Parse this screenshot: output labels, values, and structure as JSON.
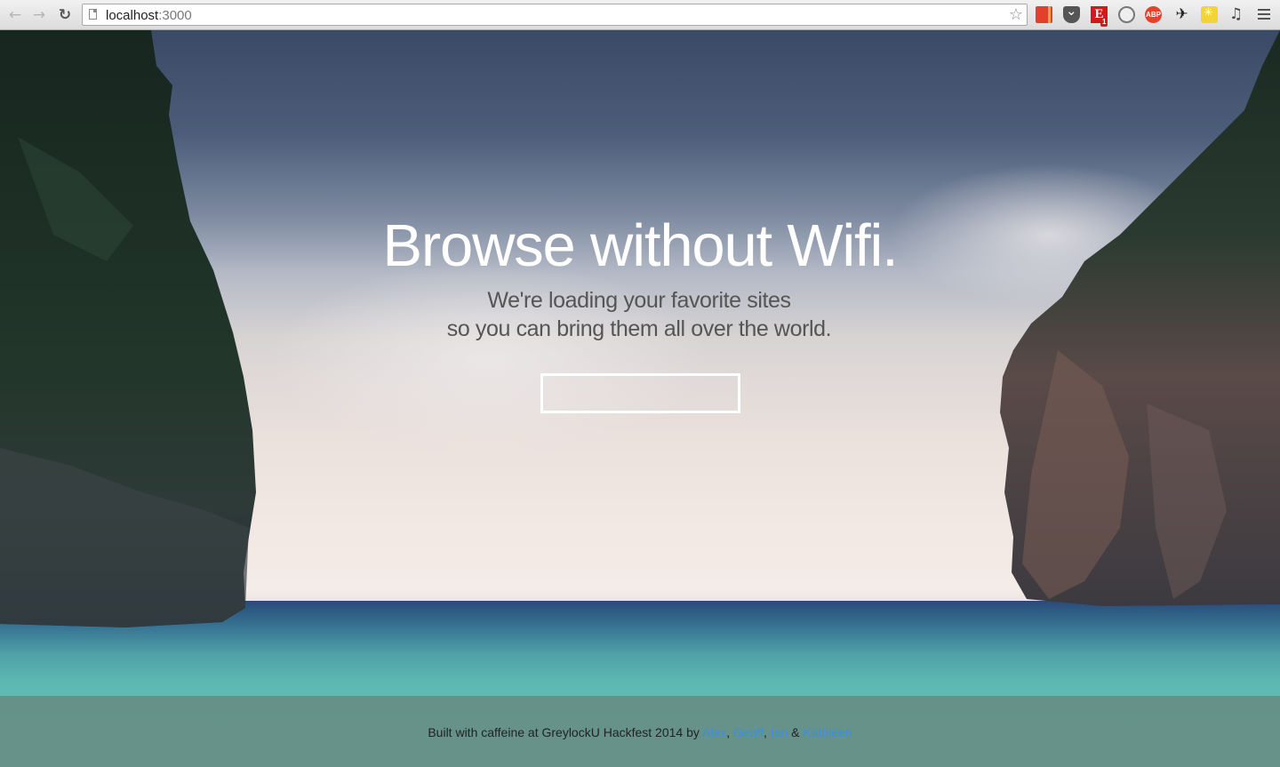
{
  "browser": {
    "url_host": "localhost",
    "url_port": ":3000",
    "extensions": [
      "bookmarks-extension",
      "pocket-extension",
      "evernote-extension",
      "ghostery-extension",
      "adblock-plus-extension",
      "stick-figure-extension",
      "yellow-extension",
      "music-extension"
    ],
    "evernote_letter": "E",
    "evernote_badge": "1",
    "abp_label": "ABP"
  },
  "hero": {
    "headline": "Browse without Wifi.",
    "subline_1": "We're loading your favorite sites",
    "subline_2": "so you can bring them all over the world."
  },
  "footer": {
    "prefix": "Built with caffeine at GreylockU Hackfest 2014 by ",
    "authors": [
      "Alex",
      "Geoff",
      "Ian",
      "Kathleen"
    ],
    "sep_1": ", ",
    "sep_2": ", ",
    "sep_3": " & "
  },
  "colors": {
    "link": "#3b8fe0",
    "footer_bg": "#67877f",
    "headline": "#ffffff"
  }
}
